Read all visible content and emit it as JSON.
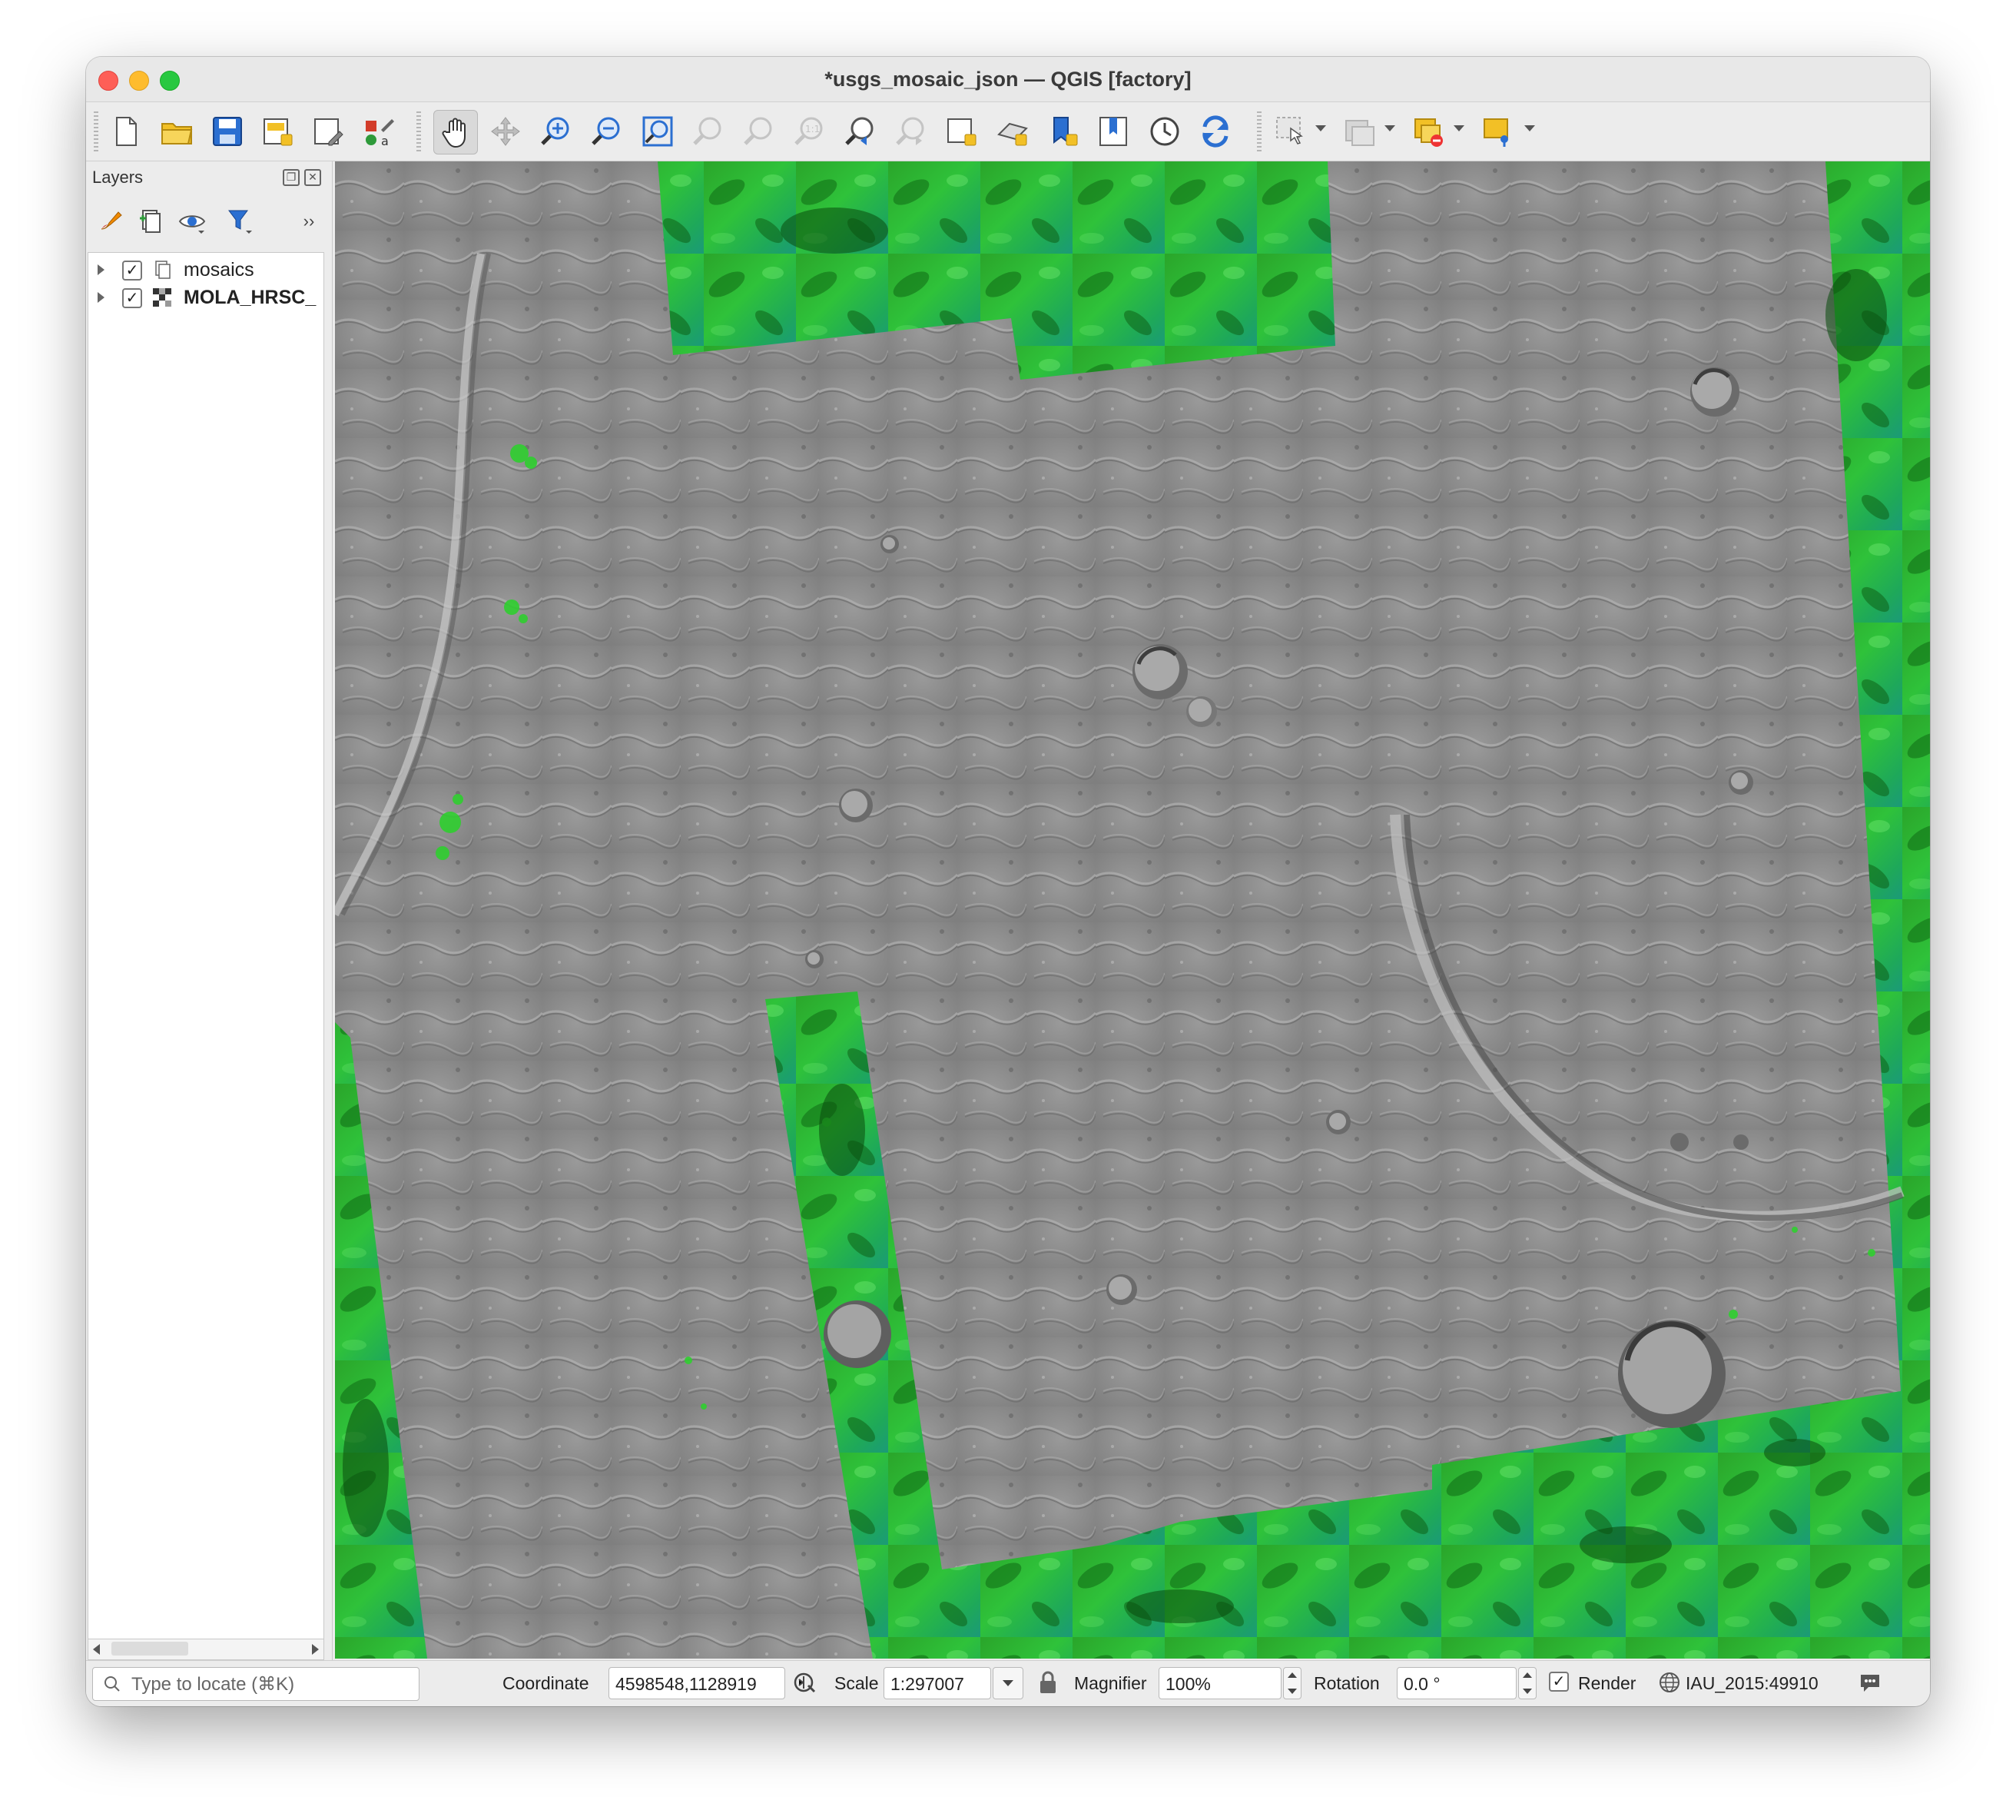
{
  "window": {
    "title": "*usgs_mosaic_json — QGIS [factory]"
  },
  "toolbar": {
    "buttons": [
      {
        "name": "new-project",
        "icon": "new-document-icon"
      },
      {
        "name": "open-project",
        "icon": "folder-icon"
      },
      {
        "name": "save-project",
        "icon": "save-icon"
      },
      {
        "name": "new-print-layout",
        "icon": "print-layout-icon"
      },
      {
        "name": "layout-manager",
        "icon": "layout-manager-icon"
      },
      {
        "name": "style-manager",
        "icon": "style-manager-icon"
      },
      {
        "name": "pan-map",
        "icon": "hand-icon"
      },
      {
        "name": "pan-to-selection",
        "icon": "pan-selection-icon"
      },
      {
        "name": "zoom-in",
        "icon": "zoom-in-icon"
      },
      {
        "name": "zoom-out",
        "icon": "zoom-out-icon"
      },
      {
        "name": "zoom-full",
        "icon": "zoom-full-icon"
      },
      {
        "name": "zoom-to-selection",
        "icon": "zoom-selection-icon"
      },
      {
        "name": "zoom-to-layer",
        "icon": "zoom-layer-icon"
      },
      {
        "name": "zoom-native",
        "icon": "zoom-native-icon"
      },
      {
        "name": "zoom-last",
        "icon": "zoom-last-icon"
      },
      {
        "name": "zoom-next",
        "icon": "zoom-next-icon"
      },
      {
        "name": "new-map-view",
        "icon": "map-view-icon"
      },
      {
        "name": "new-3d-map-view",
        "icon": "map-3d-icon"
      },
      {
        "name": "new-bookmark",
        "icon": "bookmark-icon"
      },
      {
        "name": "show-bookmarks",
        "icon": "bookmarks-icon"
      },
      {
        "name": "temporal-controller",
        "icon": "clock-icon"
      },
      {
        "name": "refresh",
        "icon": "refresh-icon"
      }
    ]
  },
  "layers_panel": {
    "title": "Layers",
    "layers": [
      {
        "name": "mosaics",
        "checked": true,
        "bold": false,
        "icon": "group-icon"
      },
      {
        "name": "MOLA_HRSC_",
        "checked": true,
        "bold": true,
        "icon": "raster-icon"
      }
    ]
  },
  "statusbar": {
    "locator_placeholder": "Type to locate (⌘K)",
    "coordinate_label": "Coordinate",
    "coordinate_value": "4598548,1128919",
    "scale_label": "Scale",
    "scale_value": "1:297007",
    "magnifier_label": "Magnifier",
    "magnifier_value": "100%",
    "rotation_label": "Rotation",
    "rotation_value": "0.0 °",
    "render_label": "Render",
    "render_checked": true,
    "crs_value": "IAU_2015:49910"
  },
  "colors": {
    "accent_blue": "#2b6fd1",
    "folder_yellow": "#f2c026",
    "map_green": "#22b02a",
    "map_gray": "#8c8c8c"
  }
}
